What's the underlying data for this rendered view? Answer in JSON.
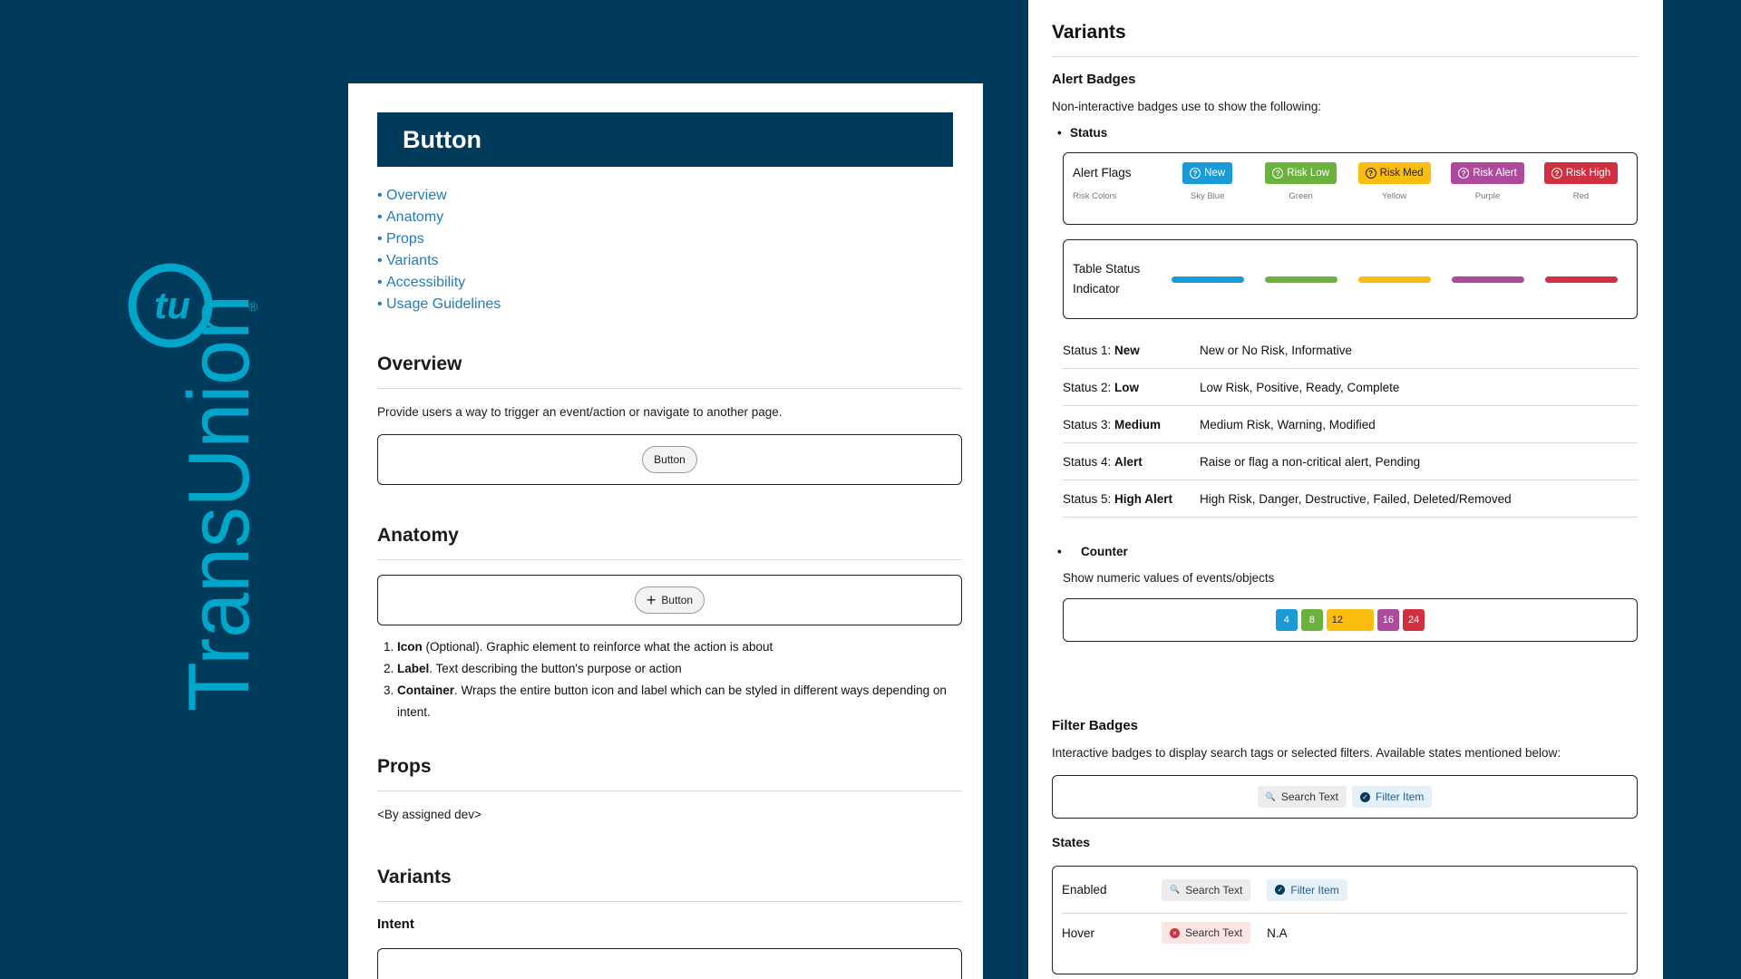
{
  "brand": {
    "name": "TransUnion",
    "mark": "tu",
    "registered": "®",
    "color": "#00a6ca",
    "bg": "#003b5c"
  },
  "left": {
    "title": "Button",
    "toc": [
      "Overview",
      "Anatomy",
      "Props",
      "Variants",
      "Accessibility",
      "Usage Guidelines"
    ],
    "toc_bullet": "•",
    "overview": {
      "heading": "Overview",
      "text": "Provide users a way to trigger an event/action or navigate to another page.",
      "button_label": "Button"
    },
    "anatomy": {
      "heading": "Anatomy",
      "button_label": "Button",
      "icon": "plus-icon",
      "items": [
        {
          "term": "Icon",
          "text": " (Optional). Graphic element to reinforce what the action is about"
        },
        {
          "term": "Label",
          "text": ". Text describing the button's purpose or action"
        },
        {
          "term": "Container",
          "text": ". Wraps the entire button icon and label which can be styled in different ways depending on intent."
        }
      ]
    },
    "props": {
      "heading": "Props",
      "text": "<By assigned dev>"
    },
    "variants": {
      "heading": "Variants",
      "sub": "Intent"
    }
  },
  "right": {
    "heading": "Variants",
    "alert": {
      "heading": "Alert Badges",
      "text": "Non-interactive badges use to show the following:",
      "bullet_status": "Status",
      "flags_label": "Alert Flags",
      "flags_sub": "Risk Colors",
      "flags": [
        {
          "label": "New",
          "sub": "Sky Blue",
          "color": "#1a9ad6"
        },
        {
          "label": "Risk Low",
          "sub": "Green",
          "color": "#6ab23c"
        },
        {
          "label": "Risk Med",
          "sub": "Yellow",
          "color": "#fbbd10"
        },
        {
          "label": "Risk Alert",
          "sub": "Purple",
          "color": "#ae4a9c"
        },
        {
          "label": "Risk High",
          "sub": "Red",
          "color": "#d0303f"
        }
      ],
      "table_status_label_1": "Table Status",
      "table_status_label_2": "Indicator",
      "statuses": [
        {
          "prefix": "Status 1: ",
          "name": "New",
          "desc": "New or No Risk, Informative"
        },
        {
          "prefix": "Status 2: ",
          "name": "Low",
          "desc": "Low Risk, Positive, Ready, Complete"
        },
        {
          "prefix": "Status 3: ",
          "name": "Medium",
          "desc": "Medium Risk, Warning, Modified"
        },
        {
          "prefix": "Status 4: ",
          "name": "Alert",
          "desc": "Raise or flag a non-critical alert, Pending"
        },
        {
          "prefix": "Status 5: ",
          "name": "High Alert",
          "desc": "High Risk, Danger, Destructive, Failed, Deleted/Removed"
        }
      ],
      "bullet_counter": "Counter",
      "counter_text": "Show numeric values of events/objects",
      "counters": [
        {
          "value": "4",
          "color": "#1a9ad6"
        },
        {
          "value": "8",
          "color": "#6ab23c"
        },
        {
          "value": "12",
          "color": "#fbbd10"
        },
        {
          "value": "16",
          "color": "#ae4a9c"
        },
        {
          "value": "24",
          "color": "#d0303f"
        }
      ]
    },
    "filter": {
      "heading": "Filter Badges",
      "text": "Interactive badges to display search tags or selected filters. Available states mentioned below:",
      "search_label": "Search Text",
      "filter_label": "Filter Item",
      "states_heading": "States",
      "state_enabled": "Enabled",
      "state_hover": "Hover",
      "hover_filter": "N.A"
    }
  }
}
